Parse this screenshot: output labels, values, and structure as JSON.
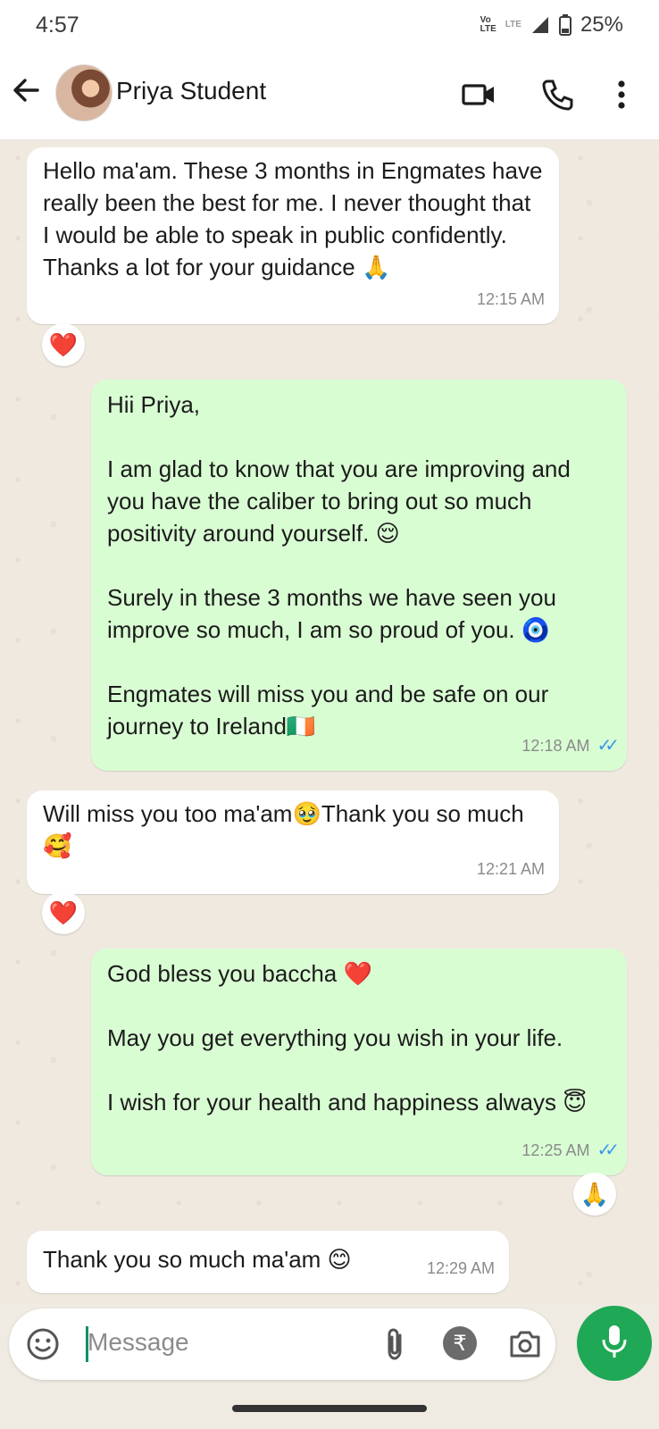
{
  "status_bar": {
    "time": "4:57",
    "network_top": "Vo",
    "network_bottom": "LTE",
    "lte_label": "LTE",
    "battery": "25%"
  },
  "header": {
    "contact_name": "Priya Student",
    "back_icon": "arrow-left-icon",
    "video_icon": "video-call-icon",
    "phone_icon": "phone-icon",
    "menu_icon": "more-vert-icon"
  },
  "messages": [
    {
      "direction": "incoming",
      "text": "Hello ma'am. These 3 months in Engmates have really been the best for me. I never thought that I would be able to speak in public confidently. Thanks a lot for your guidance 🙏",
      "time": "12:15 AM",
      "reaction": "❤️"
    },
    {
      "direction": "outgoing",
      "text": "Hii Priya,\n\nI am glad to know that you are improving and you have the caliber to bring out so much positivity around yourself. 😌\n\nSurely in these 3 months we have seen you improve so much, I am so proud of you. 🧿\n\nEngmates will miss you and be safe on our journey to Ireland🇮🇪",
      "time": "12:18 AM",
      "ticks": "✓✓"
    },
    {
      "direction": "incoming",
      "text": "Will miss you too ma'am🥹Thank you so much🥰",
      "time": "12:21 AM",
      "reaction": "❤️"
    },
    {
      "direction": "outgoing",
      "text": "God bless you baccha ❤️\n\nMay you get everything you wish in your life.\n\nI wish for your health and happiness always 😇",
      "time": "12:25 AM",
      "ticks": "✓✓",
      "reaction": "🙏"
    },
    {
      "direction": "incoming",
      "text": "Thank you so much ma'am 😊",
      "time": "12:29 AM"
    }
  ],
  "composer": {
    "placeholder": "Message",
    "emoji_icon": "emoji-icon",
    "attach_icon": "paperclip-icon",
    "rupee_icon": "rupee-icon",
    "rupee_symbol": "₹",
    "camera_icon": "camera-icon",
    "mic_icon": "mic-icon"
  },
  "colors": {
    "outgoing_bubble": "#d9fdd3",
    "incoming_bubble": "#ffffff",
    "accent": "#1fa855",
    "read_ticks": "#3a98e8"
  }
}
